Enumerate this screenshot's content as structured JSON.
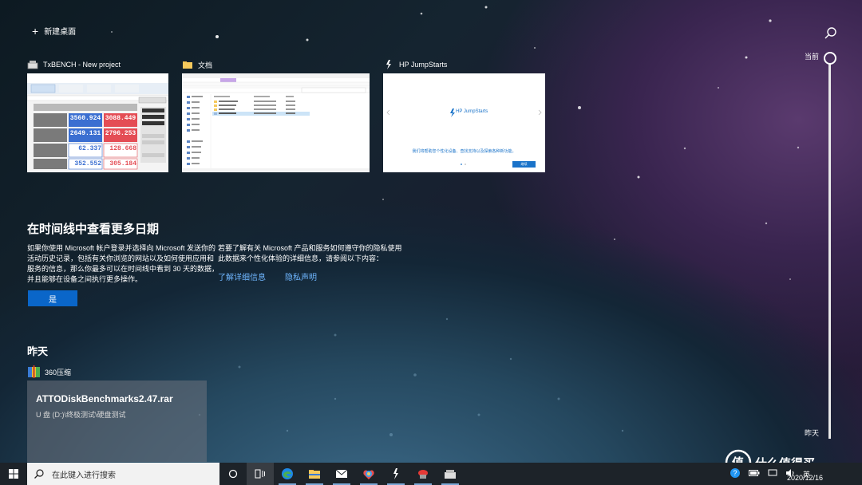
{
  "new_desktop_label": "新建桌面",
  "windows": [
    {
      "title": "TxBENCH - New project"
    },
    {
      "title": "文档"
    },
    {
      "title": "HP JumpStarts"
    }
  ],
  "txbench": {
    "tabs": [
      "Basic Benchmark",
      "Advanced Benchmark",
      "Data Erasing",
      "Drive Information"
    ],
    "col_headers": [
      "Task name",
      "Read MB/s",
      "Write MB/s"
    ],
    "rows": [
      {
        "label": "Sequential",
        "read": "3560.924",
        "write": "3088.449"
      },
      {
        "label": "Random",
        "read": "2649.131",
        "write": "2796.253"
      },
      {
        "label": "Random",
        "read": "62.337",
        "write": "128.668"
      },
      {
        "label": "Random",
        "read": "352.552",
        "write": "305.184"
      }
    ],
    "status": "Basic Benchmark finished successfully."
  },
  "hp": {
    "logo_text": "HP JumpStarts",
    "body_text": "我们将帮助您个性化设备、查找支持以及探索各种新功能。",
    "button": "继续"
  },
  "timeline": {
    "now_label": "当前",
    "yesterday_label": "昨天"
  },
  "promo": {
    "heading": "在时间线中查看更多日期",
    "left_paragraph": [
      "如果你使用 Microsoft 帐户登录并选择向 Microsoft 发送你的",
      "活动历史记录，包括有关你浏览的网站以及如何使用应用和",
      "服务的信息，那么你最多可以在时间线中看到 30 天的数据，",
      "并且能够在设备之间执行更多操作。"
    ],
    "right_paragraph": [
      "若要了解有关 Microsoft 产品和服务如何遵守你的隐私使用",
      "此数据来个性化体验的详细信息，请参阅以下内容："
    ],
    "link_details": "了解详细信息",
    "link_privacy": "隐私声明",
    "yes_button": "是"
  },
  "yesterday": {
    "heading": "昨天",
    "app_name": "360压缩",
    "card_title": "ATTODiskBenchmarks2.47.rar",
    "card_path": "U 盘 (D:)\\终极测试\\硬盘测试"
  },
  "taskbar": {
    "search_placeholder": "在此键入进行搜索",
    "date": "2020/12/16",
    "ime": "英"
  },
  "watermark": {
    "text": "什么值得买",
    "badge": "值"
  }
}
